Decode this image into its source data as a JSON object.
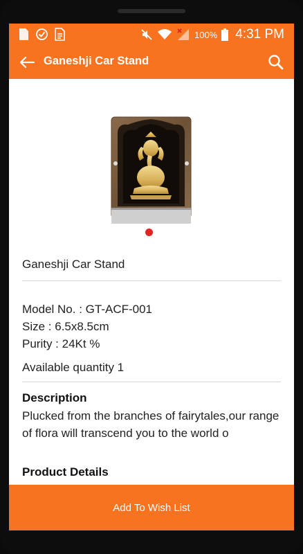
{
  "status_bar": {
    "battery": "100%",
    "time": "4:31 PM"
  },
  "app_bar": {
    "title": "Ganeshji Car Stand"
  },
  "product": {
    "name": "Ganeshji Car Stand",
    "model": "Model No. : GT-ACF-001",
    "size": "Size : 6.5x8.5cm",
    "purity": "Purity : 24Kt %",
    "quantity": "Available quantity 1"
  },
  "description": {
    "title": "Description",
    "text": "Plucked from the branches of fairytales,our range of flora will transcend you to the world o"
  },
  "product_details": {
    "title": "Product Details"
  },
  "actions": {
    "wish_list_label": "Add To Wish List"
  },
  "colors": {
    "primary": "#f7731f",
    "pager_active": "#e32222"
  }
}
